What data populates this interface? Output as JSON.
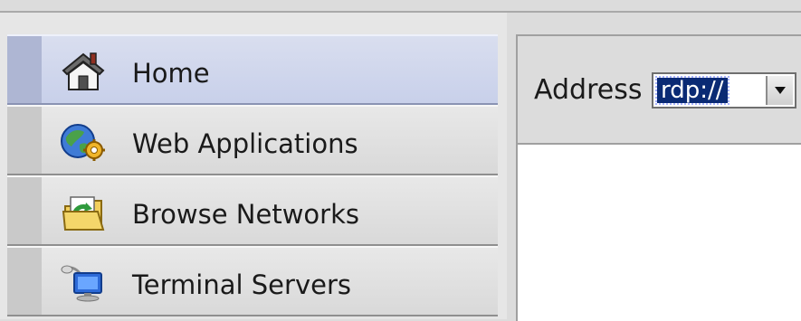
{
  "nav": {
    "items": [
      {
        "id": "home",
        "label": "Home",
        "icon": "home-icon",
        "active": true
      },
      {
        "id": "web-apps",
        "label": "Web Applications",
        "icon": "globe-gear-icon",
        "active": false
      },
      {
        "id": "browse-networks",
        "label": "Browse Networks",
        "icon": "folder-refresh-icon",
        "active": false
      },
      {
        "id": "terminal-servers",
        "label": "Terminal Servers",
        "icon": "monitor-network-icon",
        "active": false
      }
    ]
  },
  "address": {
    "label": "Address",
    "value": "rdp://"
  },
  "colors": {
    "active_nav": "#c8d0ea",
    "selection": "#0a2a74"
  }
}
